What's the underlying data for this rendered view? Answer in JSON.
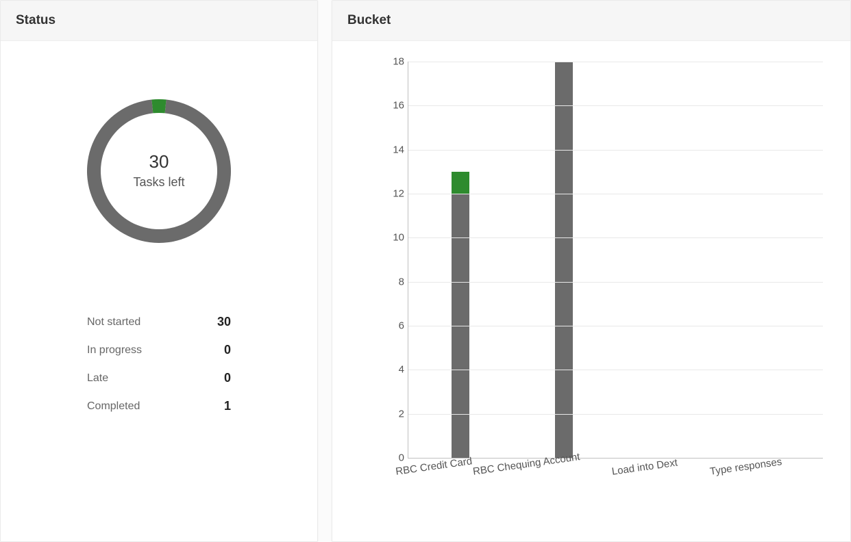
{
  "colors": {
    "not_started": "#6b6b6b",
    "completed": "#2e8b2e",
    "grid": "#e8e8e8",
    "axis": "#bfbfbf"
  },
  "status": {
    "title": "Status",
    "center_value": "30",
    "center_label": "Tasks left",
    "rows": [
      {
        "label": "Not started",
        "value": "30"
      },
      {
        "label": "In progress",
        "value": "0"
      },
      {
        "label": "Late",
        "value": "0"
      },
      {
        "label": "Completed",
        "value": "1"
      }
    ],
    "donut": {
      "total": 31,
      "slices": [
        {
          "name": "completed",
          "value": 1,
          "color_key": "completed"
        },
        {
          "name": "not_started",
          "value": 30,
          "color_key": "not_started"
        }
      ]
    }
  },
  "bucket": {
    "title": "Bucket"
  },
  "chart_data": {
    "type": "bar",
    "stacked": true,
    "ylim": [
      0,
      18
    ],
    "y_ticks": [
      0,
      2,
      4,
      6,
      8,
      10,
      12,
      14,
      16,
      18
    ],
    "categories": [
      "RBC Credit Card",
      "RBC Chequing Account",
      "Load into Dext",
      "Type responses"
    ],
    "series": [
      {
        "name": "Not started",
        "color_key": "not_started",
        "values": [
          12,
          18,
          0,
          0
        ]
      },
      {
        "name": "Completed",
        "color_key": "completed",
        "values": [
          1,
          0,
          0,
          0
        ]
      }
    ],
    "title": "Bucket",
    "xlabel": "",
    "ylabel": ""
  }
}
